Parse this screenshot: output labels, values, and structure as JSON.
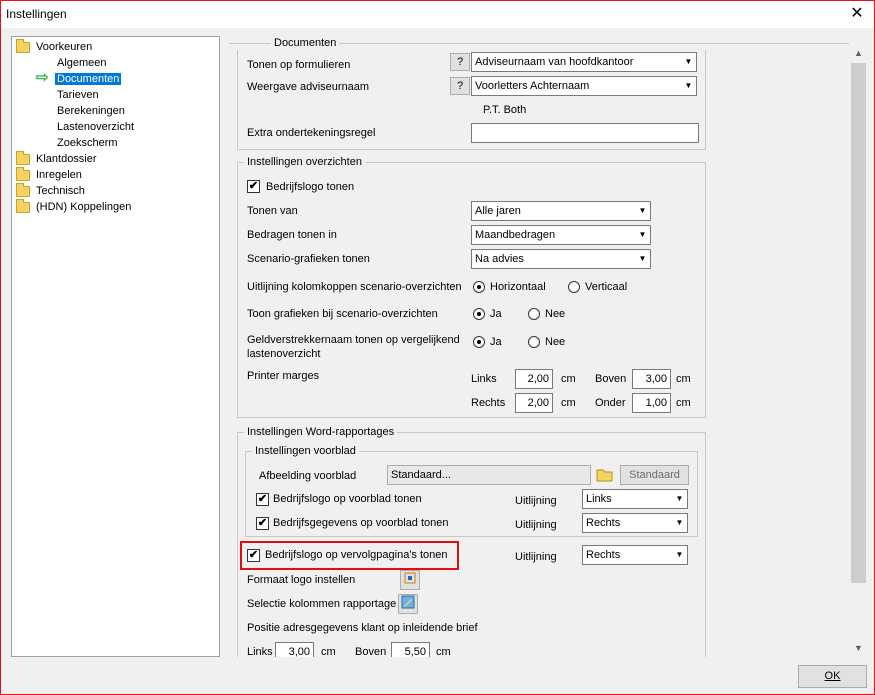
{
  "window": {
    "title": "Instellingen",
    "close_glyph": "✕"
  },
  "tree": {
    "root": "Voorkeuren",
    "children": [
      "Algemeen",
      "Documenten",
      "Tarieven",
      "Berekeningen",
      "Lastenoverzicht",
      "Zoekscherm"
    ],
    "others": [
      "Klantdossier",
      "Inregelen",
      "Technisch",
      "(HDN) Koppelingen"
    ]
  },
  "documenten": {
    "title": "Documenten",
    "tonen_op_formulieren_label": "Tonen op formulieren",
    "tonen_op_formulieren_value": "Adviseurnaam van hoofdkantoor",
    "weergave_label": "Weergave adviseurnaam",
    "weergave_value": "Voorletters Achternaam",
    "help": "?",
    "preview": "P.T. Both",
    "extra_label": "Extra ondertekeningsregel",
    "extra_value": ""
  },
  "overzichten": {
    "title": "Instellingen overzichten",
    "bedrijfslogo": "Bedrijfslogo tonen",
    "tonen_van_label": "Tonen van",
    "tonen_van_value": "Alle jaren",
    "bedragen_label": "Bedragen tonen in",
    "bedragen_value": "Maandbedragen",
    "scenario_label": "Scenario-grafieken tonen",
    "scenario_value": "Na advies",
    "uitlijning_label": "Uitlijning kolomkoppen scenario-overzichten",
    "horizontaal": "Horizontaal",
    "verticaal": "Verticaal",
    "grafieken_label": "Toon grafieken bij scenario-overzichten",
    "ja": "Ja",
    "nee": "Nee",
    "geld_label_1": "Geldverstrekkernaam tonen op vergelijkend",
    "geld_label_2": "lastenoverzicht",
    "printer_label": "Printer marges",
    "links": "Links",
    "rechts": "Rechts",
    "boven": "Boven",
    "onder": "Onder",
    "cm": "cm",
    "links_val": "2,00",
    "rechts_val": "2,00",
    "boven_val": "3,00",
    "onder_val": "1,00"
  },
  "word": {
    "title": "Instellingen Word-rapportages",
    "voorblad_title": "Instellingen voorblad",
    "afbeelding_label": "Afbeelding voorblad",
    "afbeelding_value": "Standaard...",
    "standaard_btn": "Standaard",
    "logo_voorblad": "Bedrijfslogo op voorblad tonen",
    "gegevens_voorblad": "Bedrijfsgegevens op voorblad tonen",
    "uitlijning": "Uitlijning",
    "logo_voorblad_align": "Links",
    "gegevens_voorblad_align": "Rechts",
    "logo_vervolg": "Bedrijfslogo op vervolgpagina's tonen",
    "logo_vervolg_align": "Rechts",
    "formaat_logo": "Formaat logo instellen",
    "selectie_kolommen": "Selectie kolommen rapportage",
    "positie_label": "Positie adresgegevens klant op inleidende brief",
    "pos_links": "Links",
    "pos_links_val": "3,00",
    "pos_boven": "Boven",
    "pos_boven_val": "5,50",
    "cm": "cm"
  },
  "ok": "OK"
}
